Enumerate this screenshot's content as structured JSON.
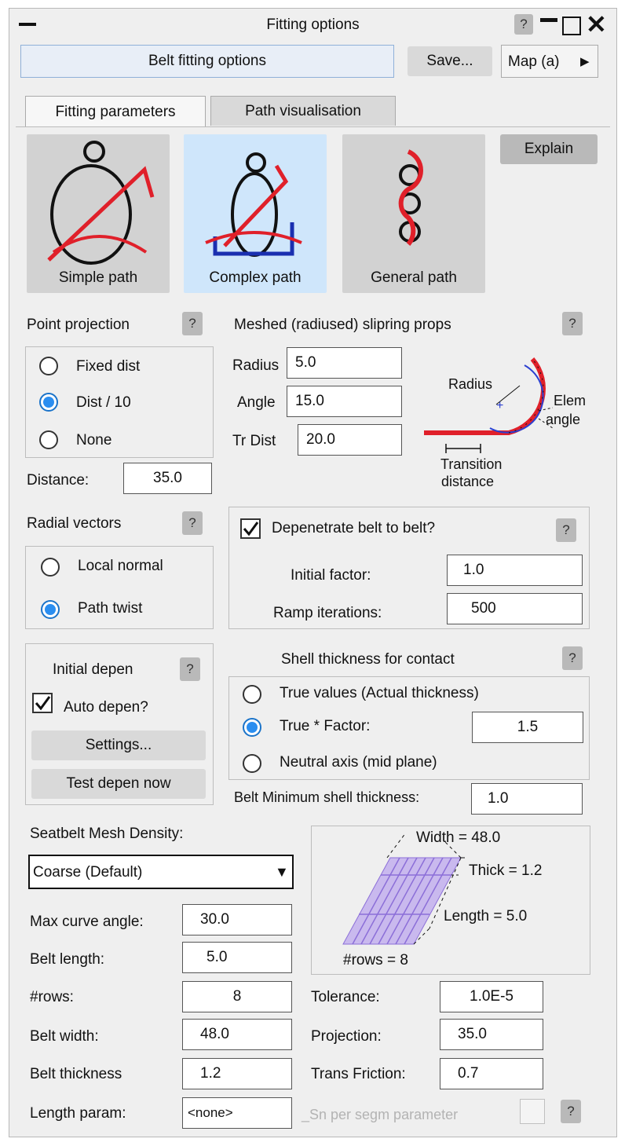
{
  "window": {
    "title": "Fitting options",
    "help": "?",
    "minimize": "—",
    "close": "✕"
  },
  "header": {
    "mode_label": "Belt fitting options",
    "save_label": "Save...",
    "map_label": "Map (a)",
    "map_arrow": "▶"
  },
  "tabs": [
    {
      "label": "Fitting parameters"
    },
    {
      "label": "Path visualisation"
    }
  ],
  "paths": {
    "simple": "Simple path",
    "complex": "Complex path",
    "general": "General path",
    "explain": "Explain"
  },
  "point_projection": {
    "title": "Point projection",
    "options": [
      "Fixed dist",
      "Dist / 10",
      "None"
    ],
    "selected": "Dist / 10",
    "distance_label": "Distance:",
    "distance_value": "35.0"
  },
  "slipring": {
    "title": "Meshed (radiused) slipring props",
    "radius_label": "Radius",
    "radius_value": "5.0",
    "angle_label": "Angle",
    "angle_value": "15.0",
    "trdist_label": "Tr Dist",
    "trdist_value": "20.0",
    "diagram": {
      "radius": "Radius",
      "elem": "Elem",
      "angle": "angle",
      "transition": "Transition",
      "distance": "distance"
    }
  },
  "radial_vectors": {
    "title": "Radial vectors",
    "options": [
      "Local normal",
      "Path twist"
    ],
    "selected": "Path twist"
  },
  "depenetrate": {
    "label": "Depenetrate belt to belt?",
    "checked": true,
    "initial_factor_label": "Initial factor:",
    "initial_factor_value": "1.0",
    "ramp_label": "Ramp iterations:",
    "ramp_value": "500"
  },
  "initial_depen": {
    "title": "Initial depen",
    "auto_label": "Auto depen?",
    "auto_checked": true,
    "settings_label": "Settings...",
    "test_label": "Test depen now"
  },
  "shell_thickness": {
    "title": "Shell thickness for contact",
    "options": [
      "True values (Actual thickness)",
      "True * Factor:",
      "Neutral axis (mid plane)"
    ],
    "selected": "True * Factor:",
    "factor_value": "1.5",
    "min_label": "Belt Minimum shell thickness:",
    "min_value": "1.0"
  },
  "mesh": {
    "density_label": "Seatbelt Mesh Density:",
    "density_value": "Coarse (Default)",
    "max_curve_label": "Max curve angle:",
    "max_curve_value": "30.0",
    "belt_length_label": "Belt length:",
    "belt_length_value": "5.0",
    "rows_label": "#rows:",
    "rows_value": "8",
    "belt_width_label": "Belt width:",
    "belt_width_value": "48.0",
    "belt_thickness_label": "Belt thickness",
    "belt_thickness_value": "1.2",
    "length_param_label": "Length param:",
    "length_param_value": "<none>",
    "diagram": {
      "width": "Width = 48.0",
      "thick": "Thick = 1.2",
      "length": "Length = 5.0",
      "rows": "#rows = 8"
    }
  },
  "misc": {
    "tolerance_label": "Tolerance:",
    "tolerance_value": "1.0E-5",
    "projection_label": "Projection:",
    "projection_value": "35.0",
    "trans_friction_label": "Trans Friction:",
    "trans_friction_value": "0.7",
    "sn_label": "_Sn per segm parameter"
  },
  "colors": {
    "accent": "#2b8ef0",
    "belt_red": "#e0202a",
    "selected_tile": "#cfe6fb",
    "mesh_purple": "#8c6fd8"
  }
}
